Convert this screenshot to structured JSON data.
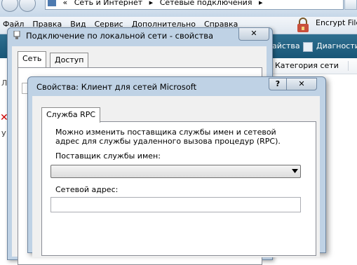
{
  "explorer": {
    "address": [
      "«",
      "Сеть и Интернет",
      "▸",
      "Сетевые подключения",
      "▸"
    ],
    "menu": [
      "Файл",
      "Правка",
      "Вид",
      "Сервис",
      "Дополнительно",
      "Справка"
    ],
    "toolbar_fragments": [
      "айства",
      "Диагности"
    ],
    "encrypt_label": "Encrypt File",
    "column_header": "Категория сети",
    "left_fragments": [
      "Л",
      "У"
    ]
  },
  "dialog1": {
    "title": "Подключение по локальной сети - свойства",
    "close": "✕",
    "tabs": [
      "Сеть",
      "Доступ"
    ],
    "fragment": "С"
  },
  "dialog2": {
    "title": "Свойства: Клиент для сетей Microsoft",
    "help": "?",
    "close": "✕",
    "tab": "Служба RPC",
    "description": "Можно изменить поставщика службы имен и сетевой адрес для службы удаленного вызова процедур (RPC).",
    "provider_label": "Поставщик службы имен:",
    "provider_value": "",
    "address_label": "Сетевой адрес:",
    "address_value": ""
  },
  "colors": {
    "toolbar_bg": "#185677",
    "title_bar": "#bfd2e5",
    "close_red": "#c94f3c"
  }
}
